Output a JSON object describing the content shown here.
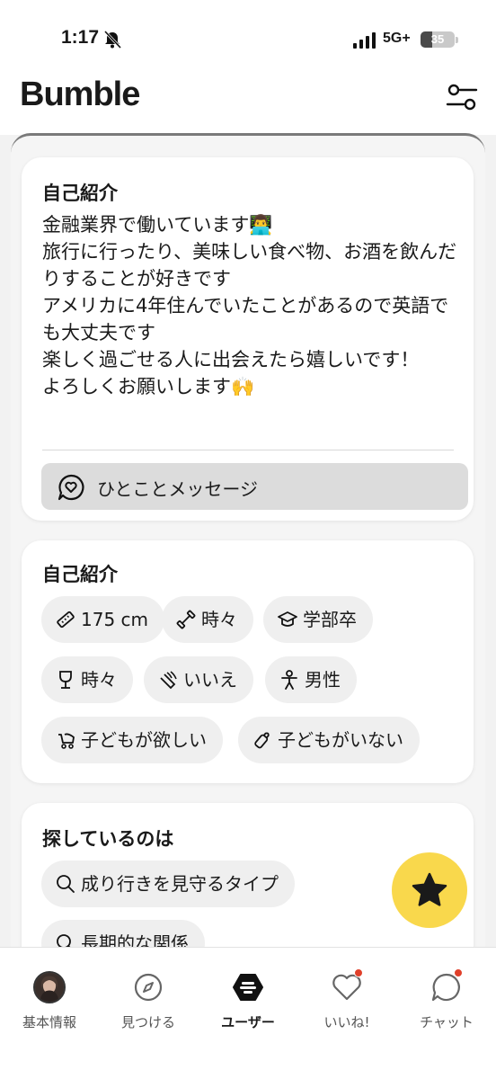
{
  "status_bar": {
    "time": "1:17",
    "network": "5G+",
    "battery": "35",
    "battery_level": 0.35
  },
  "header": {
    "logo": "Bumble",
    "filter_icon": "sliders-icon"
  },
  "bio_card": {
    "title": "自己紹介",
    "text": "金融業界で働いています👨‍💻\n旅行に行ったり、美味しい食べ物、お酒を飲んだりすることが好きです\nアメリカに4年住んでいたことがあるので英語でも大丈夫です\n楽しく過ごせる人に出会えたら嬉しいです！\nよろしくお願いします🙌",
    "message_button": "ひとことメッセージ"
  },
  "basics_card": {
    "title": "自己紹介",
    "chips": [
      {
        "icon": "ruler-icon",
        "label": "175 cm"
      },
      {
        "icon": "dumbbell-icon",
        "label": "時々"
      },
      {
        "icon": "graduation-cap-icon",
        "label": "学部卒"
      },
      {
        "icon": "wine-glass-icon",
        "label": "時々"
      },
      {
        "icon": "no-smoking-icon",
        "label": "いいえ"
      },
      {
        "icon": "person-icon",
        "label": "男性"
      },
      {
        "icon": "stroller-icon",
        "label": "子どもが欲しい"
      },
      {
        "icon": "baby-bottle-icon",
        "label": "子どもがいない"
      }
    ]
  },
  "looking_for_card": {
    "title": "探しているのは",
    "chips": [
      {
        "icon": "search-icon",
        "label": "成り行きを見守るタイプ"
      },
      {
        "icon": "search-icon",
        "label": "長期的な関係"
      }
    ]
  },
  "tabs": [
    {
      "label": "基本情報",
      "icon": "avatar",
      "active": false
    },
    {
      "label": "見つける",
      "icon": "compass-icon",
      "active": false
    },
    {
      "label": "ユーザー",
      "icon": "bumble-hive-icon",
      "active": true
    },
    {
      "label": "いいね!",
      "icon": "heart-icon",
      "active": false,
      "badge": true
    },
    {
      "label": "チャット",
      "icon": "chat-icon",
      "active": false,
      "badge": true
    }
  ],
  "colors": {
    "accent": "#f9d84c",
    "badge": "#e0402a",
    "chip_bg": "#efefef"
  }
}
